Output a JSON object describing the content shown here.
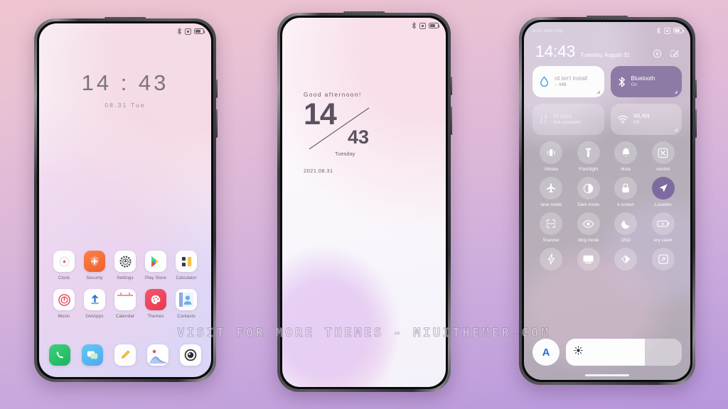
{
  "background": {
    "top_color": "#eec4ce",
    "bottom_color": "#b896dc"
  },
  "watermark": {
    "text": "VISIT FOR MORE THEMES - MIUITHEMER.COM"
  },
  "phone1": {
    "name": "home-screen",
    "statusbar": {
      "left_text": "",
      "icons": [
        "bluetooth-icon",
        "vibrate-icon",
        "battery-icon"
      ]
    },
    "clock_widget": {
      "time": "14 : 43",
      "date": "08.31   Tue"
    },
    "apps_row1": [
      {
        "label": "Clock",
        "icon": "clock-icon"
      },
      {
        "label": "Security",
        "icon": "security-shield-icon"
      },
      {
        "label": "Settings",
        "icon": "settings-gear-icon"
      },
      {
        "label": "Play Store",
        "icon": "play-store-icon"
      },
      {
        "label": "Calculator",
        "icon": "calculator-icon"
      }
    ],
    "apps_row2": [
      {
        "label": "Music",
        "icon": "music-icon"
      },
      {
        "label": "GetApps",
        "icon": "getapps-icon"
      },
      {
        "label": "Calendar",
        "icon": "calendar-icon"
      },
      {
        "label": "Themes",
        "icon": "themes-icon"
      },
      {
        "label": "Contacts",
        "icon": "contacts-icon"
      }
    ],
    "dock": [
      {
        "label": "Phone",
        "icon": "phone-icon"
      },
      {
        "label": "Messages",
        "icon": "messages-icon"
      },
      {
        "label": "Notes",
        "icon": "notes-pencil-icon"
      },
      {
        "label": "Gallery",
        "icon": "gallery-icon"
      },
      {
        "label": "Camera",
        "icon": "camera-icon"
      }
    ]
  },
  "phone2": {
    "name": "lock-screen",
    "statusbar": {
      "icons": [
        "bluetooth-icon",
        "vibrate-icon",
        "battery-icon"
      ]
    },
    "greeting": "Good afternoon!",
    "hour": "14",
    "minute": "43",
    "weekday": "Tuesday",
    "date": "2021.08.31"
  },
  "phone3": {
    "name": "control-center",
    "statusbar": {
      "left_text": "ency calls only",
      "icons": [
        "bluetooth-icon",
        "vibrate-icon",
        "battery-icon"
      ]
    },
    "header": {
      "time": "14:43",
      "date": "Tuesday, August 31",
      "settings_icon": "gear-icon",
      "edit_icon": "edit-icon"
    },
    "big_tiles": [
      {
        "title": "rd isn't install",
        "subtitle": "-- MB",
        "icon": "water-drop-icon",
        "state": "white",
        "accent": "#2f9fe0"
      },
      {
        "title": "Bluetooth",
        "subtitle": "On",
        "icon": "bluetooth-icon",
        "state": "on",
        "accent": "#8d7ba6"
      },
      {
        "title": "ile data",
        "subtitle": "Not available",
        "icon": "mobile-data-icon",
        "state": "disabled"
      },
      {
        "title": "WLAN",
        "subtitle": "Off",
        "icon": "wlan-icon",
        "state": "off"
      }
    ],
    "tiles_row3": [
      {
        "label": "Vibrate",
        "icon": "vibrate-icon",
        "active": false
      },
      {
        "label": "Flashlight",
        "icon": "flashlight-icon",
        "active": false
      },
      {
        "label": "Mute",
        "icon": "bell-icon",
        "active": false
      },
      {
        "label": "enshot",
        "icon": "screenshot-icon",
        "active": false
      }
    ],
    "tiles_row4": [
      {
        "label": "lane mode",
        "icon": "airplane-icon",
        "active": false
      },
      {
        "label": "Dark mode",
        "icon": "dark-mode-icon",
        "active": false
      },
      {
        "label": "k screen",
        "icon": "lock-icon",
        "active": false
      },
      {
        "label": "Location",
        "icon": "location-arrow-icon",
        "active": true
      }
    ],
    "tiles_row5": [
      {
        "label": "Scanner",
        "icon": "scanner-icon",
        "active": false
      },
      {
        "label": "ding mode",
        "icon": "eye-icon",
        "active": false
      },
      {
        "label": "DND",
        "icon": "moon-icon",
        "active": false
      },
      {
        "label": "ery saver",
        "icon": "battery-saver-icon",
        "active": false
      }
    ],
    "tiles_row6": [
      {
        "label": "",
        "icon": "lightning-icon",
        "active": false
      },
      {
        "label": "",
        "icon": "cast-screen-icon",
        "active": false
      },
      {
        "label": "",
        "icon": "contrast-icon",
        "active": false
      },
      {
        "label": "",
        "icon": "fullscreen-icon",
        "active": false
      }
    ],
    "brightness": {
      "auto_label": "A",
      "icon": "sun-icon",
      "percent": 68
    }
  }
}
